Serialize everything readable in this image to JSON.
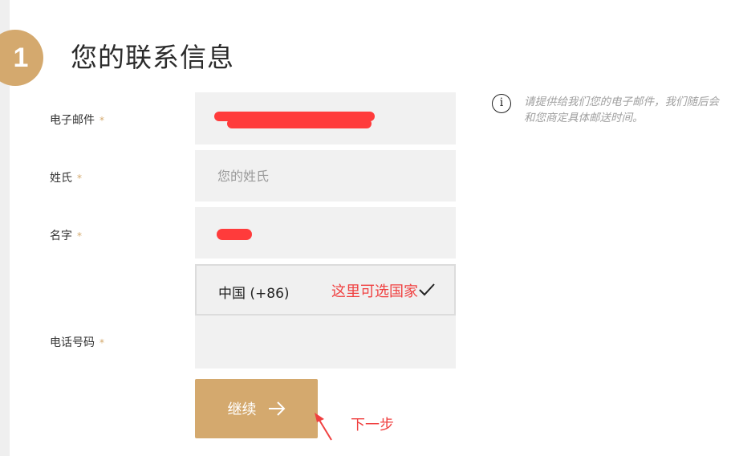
{
  "step": {
    "number": "1",
    "title": "您的联系信息"
  },
  "form": {
    "email_label": "电子邮件",
    "surname_label": "姓氏",
    "surname_placeholder": "您的姓氏",
    "given_name_label": "名字",
    "phone_label": "电话号码",
    "required_mark": "*",
    "country_value": "中国 (+86)"
  },
  "info": {
    "text": "请提供给我们您的电子邮件，我们随后会和您商定具体邮送时间。"
  },
  "actions": {
    "continue_label": "继续"
  },
  "annotations": {
    "country_hint": "这里可选国家",
    "next_hint": "下一步"
  },
  "colors": {
    "accent": "#d4a96e",
    "annotation": "#f04040",
    "field_bg": "#f1f1f1"
  }
}
